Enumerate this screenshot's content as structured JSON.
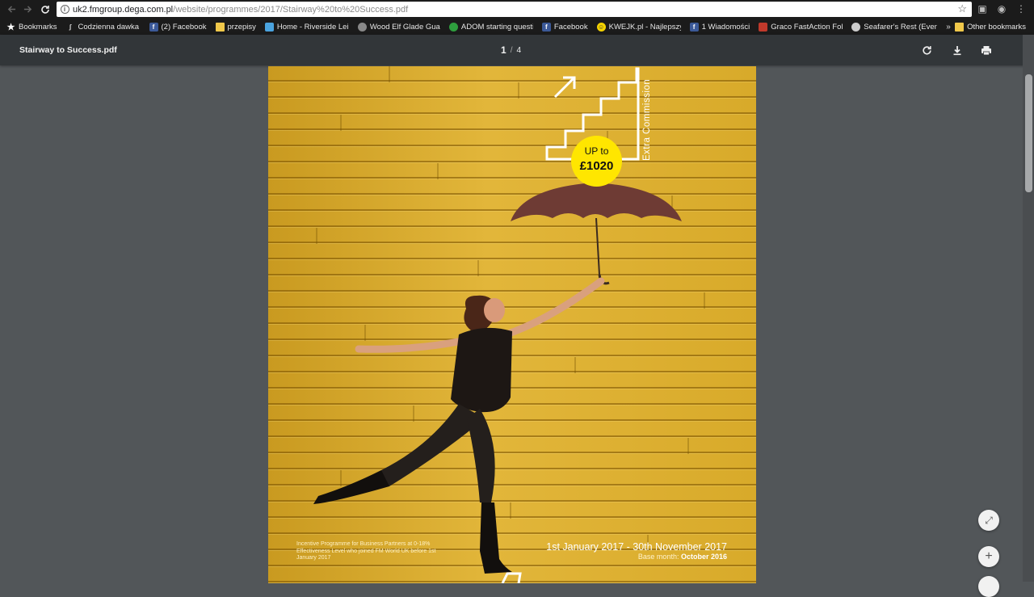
{
  "browser": {
    "url_host": "uk2.fmgroup.dega.com.pl",
    "url_path": "/website/programmes/2017/Stairway%20to%20Success.pdf"
  },
  "bookmarks_bar": {
    "items": [
      {
        "label": "Bookmarks",
        "icon": "star-icon"
      },
      {
        "label": "Codzienna dawka cza",
        "icon": "page-icon"
      },
      {
        "label": "(2) Facebook",
        "icon": "facebook-icon"
      },
      {
        "label": "przepisy",
        "icon": "folder-icon"
      },
      {
        "label": "Home - Riverside Leis",
        "icon": "site-icon"
      },
      {
        "label": "Wood Elf Glade Guar",
        "icon": "site-icon"
      },
      {
        "label": "ADOM starting questi",
        "icon": "site-icon"
      },
      {
        "label": "Facebook",
        "icon": "facebook-icon"
      },
      {
        "label": "KWEJK.pl - Najlepszy",
        "icon": "smiley-icon"
      },
      {
        "label": "1 Wiadomości",
        "icon": "facebook-icon"
      },
      {
        "label": "Graco FastAction Fol",
        "icon": "site-icon"
      },
      {
        "label": "Seafarer's Rest (Event",
        "icon": "site-icon"
      }
    ],
    "more": "»",
    "other": "Other bookmarks"
  },
  "pdf_viewer": {
    "title": "Stairway to Success.pdf",
    "current_page": "1",
    "separator": "/",
    "total_pages": "4"
  },
  "pdf_page": {
    "badge_top": "UP to",
    "badge_amount": "£1020",
    "vertical_label": "Extra Commission",
    "incentive_text": "Incentive Programme for Business Partners at 0-18% Effectiveness Level who joined FM World UK before 1st January 2017",
    "date_range": "1st January 2017 - 30th November 2017",
    "base_month_label": "Base month:",
    "base_month_value": "October 2016"
  },
  "floating_controls": {
    "fit": "⤢",
    "zoom_in": "+"
  },
  "colors": {
    "page_yellow": "#d9ad2c",
    "badge_yellow": "#ffe600",
    "toolbar": "#323639",
    "viewer_bg": "#525659"
  }
}
